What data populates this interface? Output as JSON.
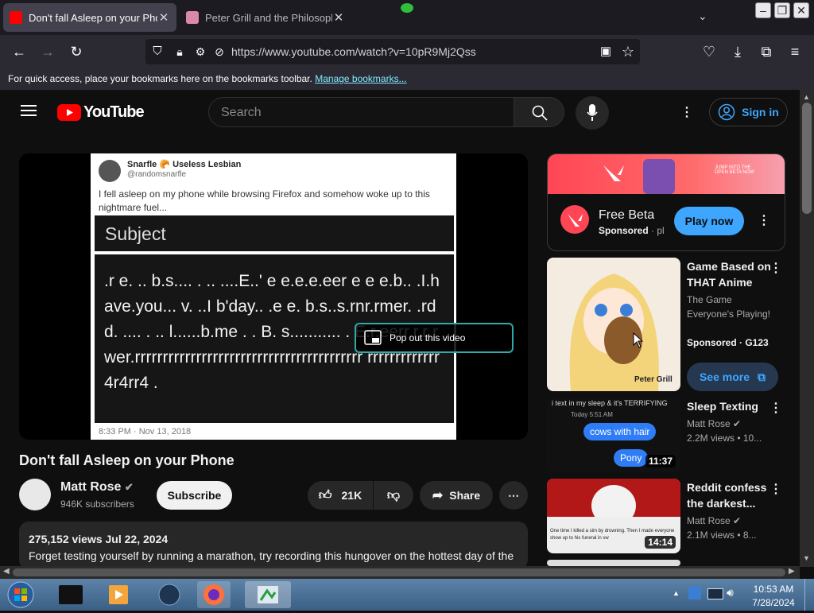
{
  "browser": {
    "tabs": [
      {
        "title": "Don't fall Asleep on your Phone",
        "active": true
      },
      {
        "title": "Peter Grill and the Philosopher",
        "active": false
      }
    ],
    "url": "https://www.youtube.com/watch?v=10pR9Mj2Qss",
    "bookmarks_notice": "For quick access, place your bookmarks here on the bookmarks toolbar.",
    "bookmarks_link": "Manage bookmarks..."
  },
  "youtube": {
    "logo_text": "YouTube",
    "search_placeholder": "Search",
    "sign_in": "Sign in",
    "video": {
      "tweet_author": "Snarfle 🥐 Useless Lesbian",
      "tweet_handle": "@randomsnarfle",
      "tweet_text": "I fell asleep on my phone while browsing Firefox and somehow woke up to this nightmare fuel...",
      "subject": "Subject",
      "body": ".r e.  .. b.s....  .  .. ....E..' e e.e.e.eer e e e.b.. .I.have.you... v.  ..I b'day.. .e e. b.s..s.rnr.rmer.  .rdd.    ....  .  ..    l......b.me . .  B.    s........... . E.r.eerr.r.r rwer.rrrrrrrrrrrrrrrrrrrrrrrrrrrrrrrrrrrrrrrrr rrrrrrrrrrrrr4r4rr4 .",
      "tweet_date": "8:33 PM · Nov 13, 2018",
      "popout_label": "Pop out this video",
      "title": "Don't fall Asleep on your Phone",
      "channel": "Matt Rose",
      "subscribers": "946K subscribers",
      "subscribe": "Subscribe",
      "likes": "21K",
      "share": "Share",
      "views_date": "275,152 views  Jul 22, 2024",
      "description": "Forget testing yourself by running a marathon, try recording this hungover on the hottest day of the"
    },
    "ad": {
      "banner_text": "JUMP INTO THE OPEN BETA NOW",
      "title": "Free Beta",
      "sponsored": "Sponsored",
      "sponsor_tail": "· pl",
      "cta": "Play now"
    },
    "related": [
      {
        "title": "Game Based on THAT Anime",
        "channel": "The Game Everyone's Playing!",
        "meta": "Sponsored · G123",
        "cta": "See more",
        "thumb_text": "Peter Grill"
      },
      {
        "title": "Sleep Texting",
        "channel": "Matt Rose",
        "meta": "2.2M views  • 10...",
        "duration": "11:37",
        "thumb_caption": "i text in my sleep & it's TERRIFYING",
        "thumb_time": "Today 5:51 AM",
        "bubble1": "cows with hair",
        "bubble2": "Pony"
      },
      {
        "title": "Reddit confess the darkest...",
        "channel": "Matt Rose",
        "meta": "2.1M views  • 8...",
        "duration": "14:14",
        "thumb_text": "One time I killed a sim by drowning. Then I made everyone show up to his funeral in sw"
      }
    ]
  },
  "taskbar": {
    "time": "10:53 AM",
    "date": "7/28/2024"
  },
  "colors": {
    "yt_red": "#ff0000",
    "accent_blue": "#3ea6ff",
    "play_now": "#3ea6ff",
    "popout_border": "#2fa9a9"
  }
}
